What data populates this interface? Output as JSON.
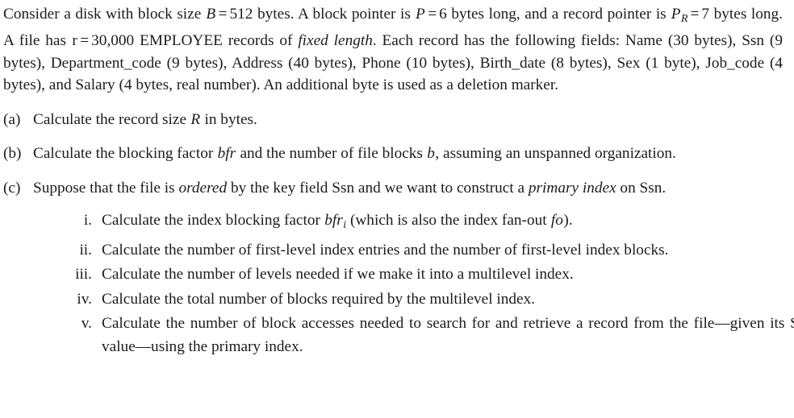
{
  "document": {
    "type": "textbook-exercise",
    "background_color": "#ffffff",
    "text_color": "#1c1c1c"
  },
  "intro": {
    "s1": "Consider a disk with block size",
    "v_B": "B",
    "eq1": "=",
    "n_512": "512",
    "s2": "bytes.  A block pointer is",
    "v_P": "P",
    "eq2": "=",
    "n_6": "6",
    "s3": "bytes long, and a record pointer is",
    "v_PR": "P",
    "v_PR_sub": "R",
    "eq3": "=",
    "n_7": "7",
    "s4": "bytes long.  A file has",
    "v_r": "r",
    "eq4": "=",
    "n_30000": "30,000",
    "s5": "EMPLOYEE records of",
    "em_fixed_length": "fixed length",
    "s6": ".  Each record has the following fields: Name (30 bytes), Ssn (9 bytes), Department_code (9 bytes), Address (40 bytes), Phone (10 bytes), Birth_date (8 bytes), Sex (1 byte), Job_code (4 bytes), and Salary (4 bytes, real number).  An additional byte is used as a deletion marker."
  },
  "parts": {
    "a": {
      "marker": "(a)",
      "t1": "Calculate the record size",
      "v_R": "R",
      "t2": "in bytes."
    },
    "b": {
      "marker": "(b)",
      "t1": "Calculate the blocking factor",
      "v_bfr": "bfr",
      "t2": "and the number of file blocks",
      "v_b": "b",
      "t3": ", assuming an unspanned organization."
    },
    "c": {
      "marker": "(c)",
      "t1": "Suppose that the file is",
      "em_ordered": "ordered",
      "t2": "by the key field Ssn and we want to construct a",
      "em_primary_index": "primary index",
      "t3": "on Ssn."
    }
  },
  "subparts": [
    {
      "marker": "i.",
      "t1": "Calculate the index blocking factor",
      "v_bfr": "bfr",
      "v_bfr_sub": "i",
      "t2": "(which is also the index fan-out",
      "v_fo": "fo",
      "t3": ")."
    },
    {
      "marker": "ii.",
      "t1": "Calculate the number of first-level index entries and the number of first-level index blocks."
    },
    {
      "marker": "iii.",
      "t1": "Calculate the number of levels needed if we make it into a multilevel index."
    },
    {
      "marker": "iv.",
      "t1": "Calculate the total number of blocks required by the multilevel index."
    },
    {
      "marker": "v.",
      "t1": "Calculate the number of block accesses needed to search for and retrieve a record from the file",
      "dash1": "—",
      "t2": "given its Ssn value",
      "dash2": "—",
      "t3": "using the primary index."
    }
  ]
}
